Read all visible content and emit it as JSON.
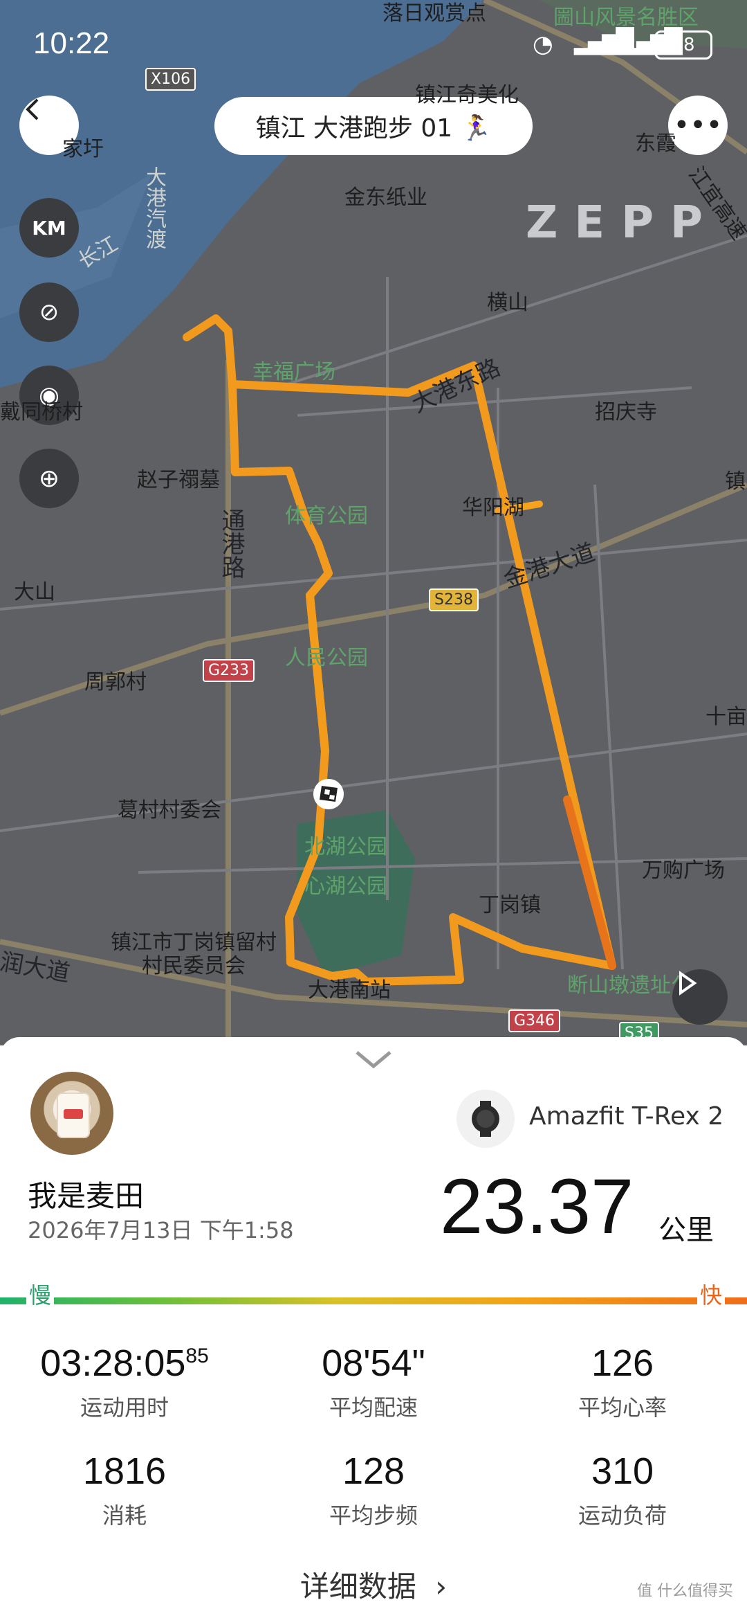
{
  "status_bar": {
    "time": "10:22",
    "battery": "58"
  },
  "header": {
    "title": "镇江 大港跑步 01 🏃‍♀️"
  },
  "map": {
    "brand_watermark": "ZEPP",
    "labels": {
      "l1": "落日观赏点",
      "l2": "圌山风景名胜区",
      "l3": "镇江奇美化",
      "l4": "东霞",
      "l5": "金东纸业",
      "l6": "江宜高速",
      "l7": "长江",
      "l8": "大港汽渡",
      "l9": "横山",
      "l10": "幸福广场",
      "l11": "大港东路",
      "l12": "招庆寺",
      "l13": "戴同桥村",
      "l14": "赵子禤墓",
      "l15": "体育公园",
      "l16": "华阳湖",
      "l17": "通港路",
      "l18": "金港大道",
      "l19": "大山",
      "l20": "人民公园",
      "l21": "周郭村",
      "l22": "十亩",
      "l23": "葛村村委会",
      "l24": "北湖公园",
      "l25": "心湖公园",
      "l26": "万购广场",
      "l27": "丁岗镇",
      "l28": "镇江市丁岗镇留村村民委员会",
      "l29": "润大道",
      "l30": "大港南站",
      "l31": "断山墩遗址公园",
      "l32": "镇三",
      "l33": "家圩"
    },
    "shields": {
      "x106": "X106",
      "g233": "G233",
      "s238": "S238",
      "g346": "G346",
      "s35": "S35"
    }
  },
  "summary": {
    "username": "我是麦田",
    "datetime": "2026年7月13日 下午1:58",
    "device": "Amazfit T-Rex 2",
    "distance": "23.37",
    "distance_unit": "公里",
    "slow_label": "慢",
    "fast_label": "快"
  },
  "stats": [
    {
      "value": "03:28:05",
      "suffix": "85",
      "label": "运动用时"
    },
    {
      "value": "08'54\"",
      "label": "平均配速"
    },
    {
      "value": "126",
      "label": "平均心率"
    },
    {
      "value": "1816",
      "label": "消耗"
    },
    {
      "value": "128",
      "label": "平均步频"
    },
    {
      "value": "310",
      "label": "运动负荷"
    }
  ],
  "detail_button": "详细数据",
  "footer_watermark": "值 什么值得买"
}
